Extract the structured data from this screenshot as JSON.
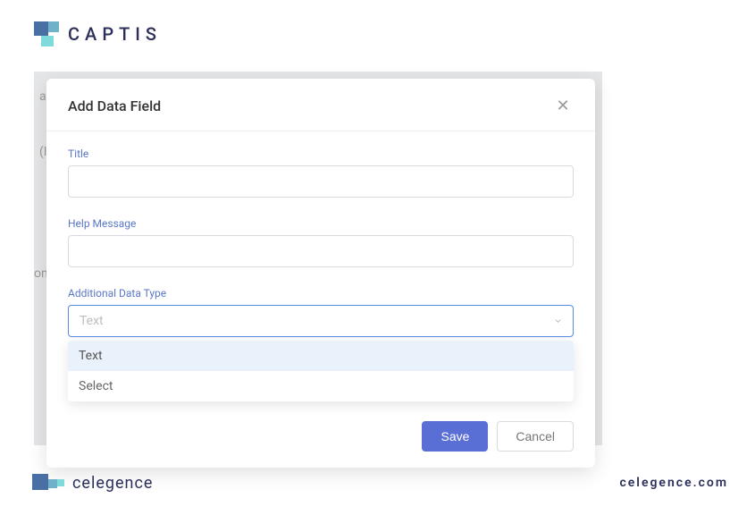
{
  "brand": {
    "top_wordmark": "CAPTIS",
    "bottom_wordmark": "celegence",
    "footer_link": "celegence.com"
  },
  "backdrop": {
    "fragment1": "a",
    "fragment2": "(I",
    "fragment3": "on"
  },
  "modal": {
    "title": "Add Data Field",
    "fields": {
      "title_label": "Title",
      "title_value": "",
      "help_label": "Help Message",
      "help_value": "",
      "type_label": "Additional Data Type",
      "type_selected": "Text"
    },
    "options": [
      {
        "label": "Text",
        "active": true
      },
      {
        "label": "Select",
        "active": false
      }
    ],
    "actions": {
      "save": "Save",
      "cancel": "Cancel"
    }
  }
}
